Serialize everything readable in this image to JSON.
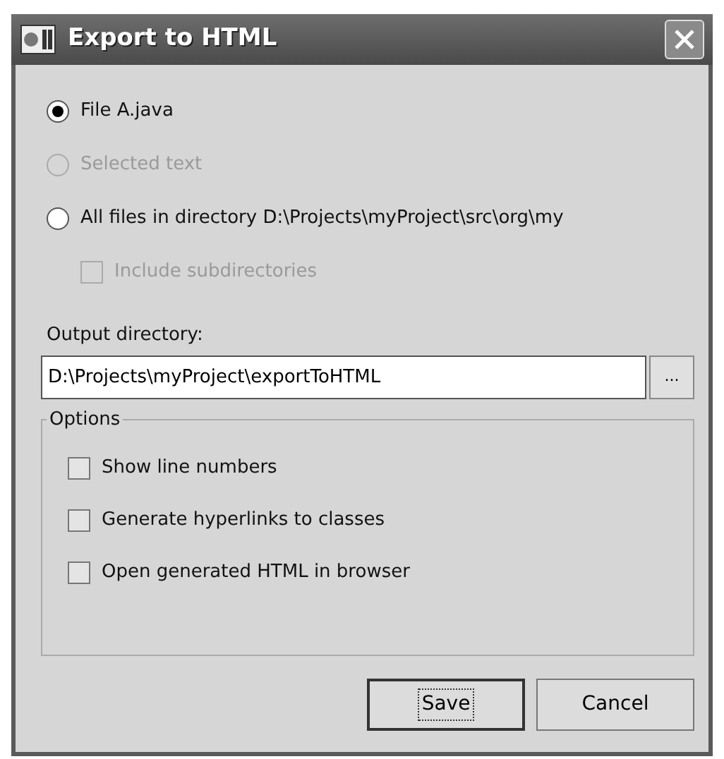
{
  "window": {
    "title": "Export to HTML"
  },
  "scope": [
    {
      "label": "File A.java",
      "selected": true,
      "disabled": false
    },
    {
      "label": "Selected text",
      "selected": false,
      "disabled": true
    },
    {
      "label": "All files in directory D:\\Projects\\myProject\\src\\org\\my",
      "selected": false,
      "disabled": false
    }
  ],
  "include_subdirectories": {
    "label": "Include subdirectories",
    "checked": false,
    "disabled": true
  },
  "output": {
    "label": "Output directory:",
    "value": "D:\\Projects\\myProject\\exportToHTML",
    "browse": "..."
  },
  "options": {
    "title": "Options",
    "items": [
      {
        "label": "Show line numbers",
        "checked": false
      },
      {
        "label": "Generate hyperlinks to classes",
        "checked": false
      },
      {
        "label": "Open generated HTML in browser",
        "checked": false
      }
    ]
  },
  "buttons": [
    {
      "label": "Save",
      "default": true
    },
    {
      "label": "Cancel",
      "default": false
    }
  ]
}
